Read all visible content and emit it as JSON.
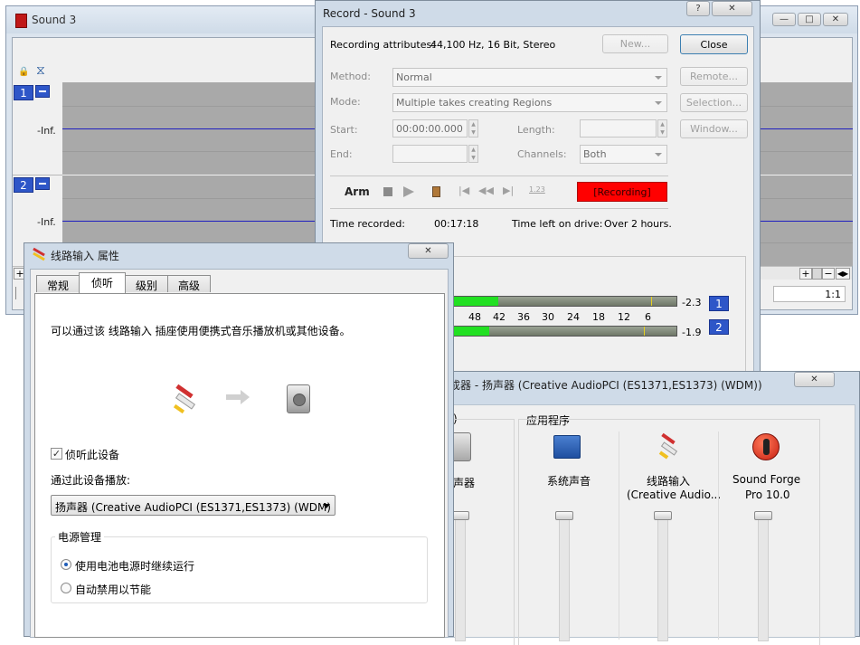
{
  "main_window": {
    "title": "Sound 3",
    "track1_number": "1",
    "track2_number": "2",
    "track1_level": "-Inf.",
    "track2_level": "-Inf.",
    "zoom_ratio": "1:1"
  },
  "record_dialog": {
    "title": "Record - Sound 3",
    "help_glyph": "?",
    "recording_attributes_label": "Recording attributes:",
    "recording_attributes_value": "44,100 Hz, 16 Bit, Stereo",
    "new_button": "New...",
    "close_button": "Close",
    "method_label": "Method:",
    "method_value": "Normal",
    "remote_button": "Remote...",
    "mode_label": "Mode:",
    "mode_value": "Multiple takes creating Regions",
    "selection_button": "Selection...",
    "start_label": "Start:",
    "start_value": "00:00:00.000",
    "length_label": "Length:",
    "window_button": "Window...",
    "end_label": "End:",
    "channels_label": "Channels:",
    "channels_value": "Both",
    "arm_label": "Arm",
    "recording_status": "[Recording]",
    "time_recorded_label": "Time recorded:",
    "time_recorded_value": "00:17:18",
    "time_left_label": "Time left on drive:",
    "time_left_value": "Over 2 hours.",
    "meter_ticks": [
      "48",
      "42",
      "36",
      "30",
      "24",
      "18",
      "12",
      "6"
    ],
    "meter1_peak": "-2.3",
    "meter2_peak": "-1.9",
    "meter1_channel": "1",
    "meter2_channel": "2",
    "meter1_level": 0.22,
    "meter2_level": 0.18
  },
  "line_in_dialog": {
    "title": "线路输入 属性",
    "tabs": [
      "常规",
      "侦听",
      "级别",
      "高级"
    ],
    "active_tab_index": 1,
    "description": "可以通过该 线路输入 插座使用便携式音乐播放机或其他设备。",
    "listen_checkbox_label": "侦听此设备",
    "listen_checked": true,
    "playback_device_label": "通过此设备播放:",
    "playback_device_value": "扬声器 (Creative AudioPCI (ES1371,ES1373) (WDM)",
    "power_group_label": "电源管理",
    "power_option1": "使用电池电源时继续运行",
    "power_option2": "自动禁用以节能",
    "power_selected": 1
  },
  "mixer_window": {
    "title": "成器 - 扬声器 (Creative AudioPCI (ES1371,ES1373) (WDM))",
    "device_group_label": ")",
    "apps_group_label": "应用程序",
    "speaker_label": "声器",
    "apps": [
      {
        "name_line1": "系统声音",
        "name_line2": ""
      },
      {
        "name_line1": "线路输入",
        "name_line2": "(Creative Audio..."
      },
      {
        "name_line1": "Sound Forge",
        "name_line2": "Pro 10.0"
      }
    ]
  },
  "colors": {
    "recording_red": "#ff0000",
    "meter_green": "#22e022",
    "channel_blue": "#2e56c8",
    "waveform_line": "#2020c0"
  }
}
